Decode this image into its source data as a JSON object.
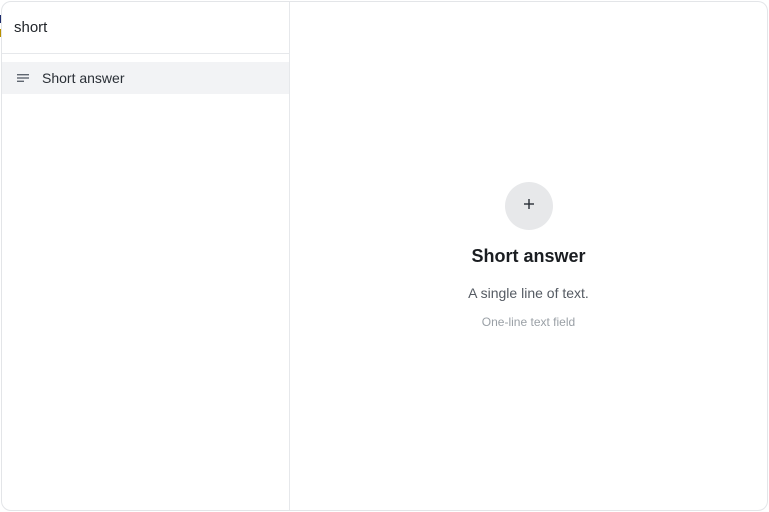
{
  "search": {
    "value": "short"
  },
  "results": [
    {
      "label": "Short answer",
      "icon": "short-text-icon"
    }
  ],
  "detail": {
    "add_icon": "plus-icon",
    "title": "Short answer",
    "description": "A single line of text.",
    "hint": "One-line text field"
  },
  "colors": {
    "selected_row": "#f2f3f5",
    "add_circle": "#e7e8ea",
    "border": "#e6e8eb",
    "hint_text": "#9aa0a6"
  }
}
